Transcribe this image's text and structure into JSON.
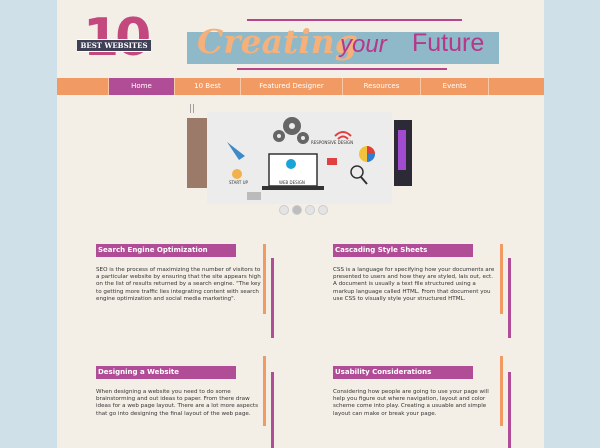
{
  "logo": {
    "number": "10",
    "band_text": "BEST WEBSITES"
  },
  "banner": {
    "creating": "Creating",
    "your": "your",
    "future": "Future"
  },
  "nav": {
    "items": [
      "Home",
      "10 Best",
      "Featured Designer",
      "Resources",
      "Events"
    ]
  },
  "slider": {
    "labels": [
      "RESPONSIVE DESIGN",
      "WEB DESIGN",
      "START UP"
    ],
    "pause": "||"
  },
  "sections": [
    {
      "title": "Search Engine Optimization",
      "body": "SEO is the process of maximizing the number of visitors to a particular website by ensuring that the site appears high on the list of results returned by a search engine. \"The key to getting more traffic lies integrating content with search engine optimization and social media marketing\"."
    },
    {
      "title": "Cascading Style Sheets",
      "body": "CSS is a language for specifying how your documents are presented to users and how they are styled, lais out, ect. A document is usually a text file structured using a markup language called HTML. From that document you use CSS to visually style your structured HTML."
    },
    {
      "title": "Designing a Website",
      "body": "When designing a website you need to do some brainstorming and out ideas to paper. From there draw ideas for a web page layout. There are a lot more aspects that go into designing the final layout of the web page."
    },
    {
      "title": "Usability Considerations",
      "body": "Considering how people are going to use your page will help you figure out where navigation, layout and color scheme come into play. Creating a usuable and simple layout can make or break your page."
    }
  ],
  "colors": {
    "accent_orange": "#f29a63",
    "accent_purple": "#b14d96",
    "banner_blue": "#8fb8c9"
  }
}
